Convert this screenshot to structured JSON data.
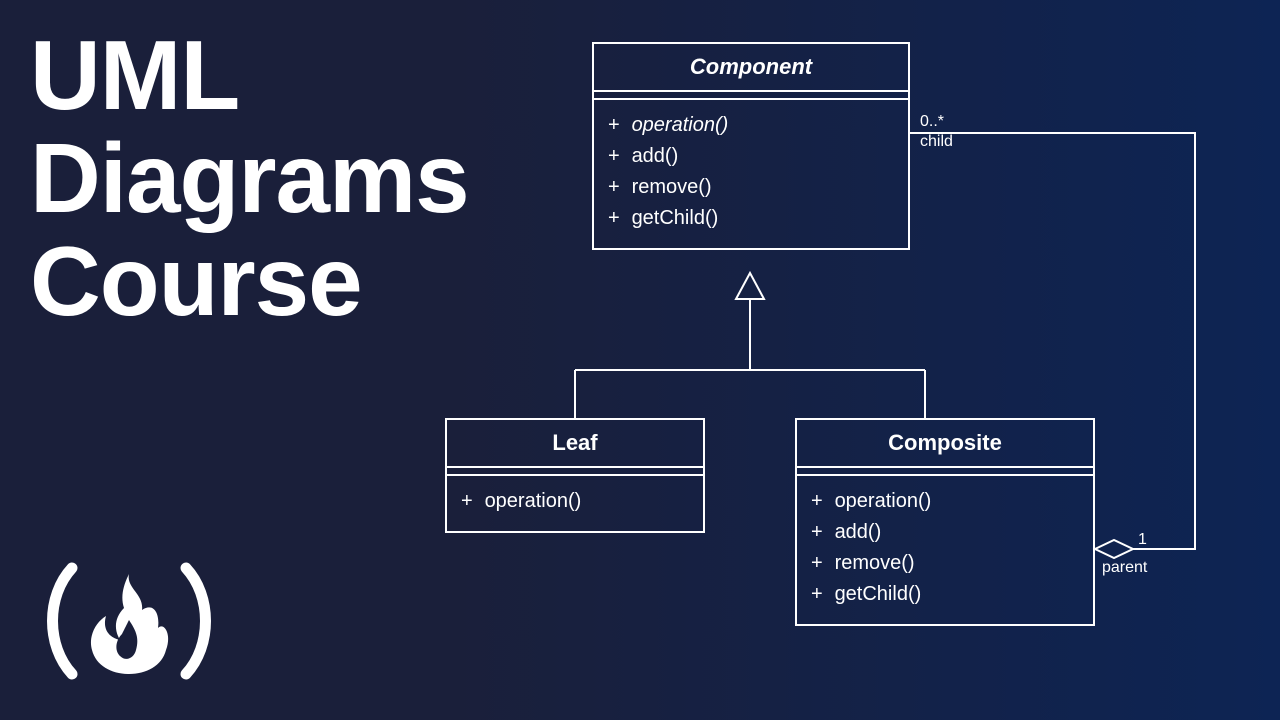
{
  "title": {
    "line1": "UML",
    "line2": "Diagrams",
    "line3": "Course"
  },
  "diagram": {
    "component": {
      "name": "Component",
      "ops": [
        {
          "vis": "+",
          "sig": "operation()",
          "italic": true
        },
        {
          "vis": "+",
          "sig": "add()",
          "italic": false
        },
        {
          "vis": "+",
          "sig": "remove()",
          "italic": false
        },
        {
          "vis": "+",
          "sig": "getChild()",
          "italic": false
        }
      ]
    },
    "leaf": {
      "name": "Leaf",
      "ops": [
        {
          "vis": "+",
          "sig": "operation()",
          "italic": false
        }
      ]
    },
    "composite": {
      "name": "Composite",
      "ops": [
        {
          "vis": "+",
          "sig": "operation()",
          "italic": false
        },
        {
          "vis": "+",
          "sig": "add()",
          "italic": false
        },
        {
          "vis": "+",
          "sig": "remove()",
          "italic": false
        },
        {
          "vis": "+",
          "sig": "getChild()",
          "italic": false
        }
      ]
    },
    "assoc": {
      "child_multiplicity": "0..*",
      "child_role": "child",
      "parent_multiplicity": "1",
      "parent_role": "parent"
    }
  }
}
